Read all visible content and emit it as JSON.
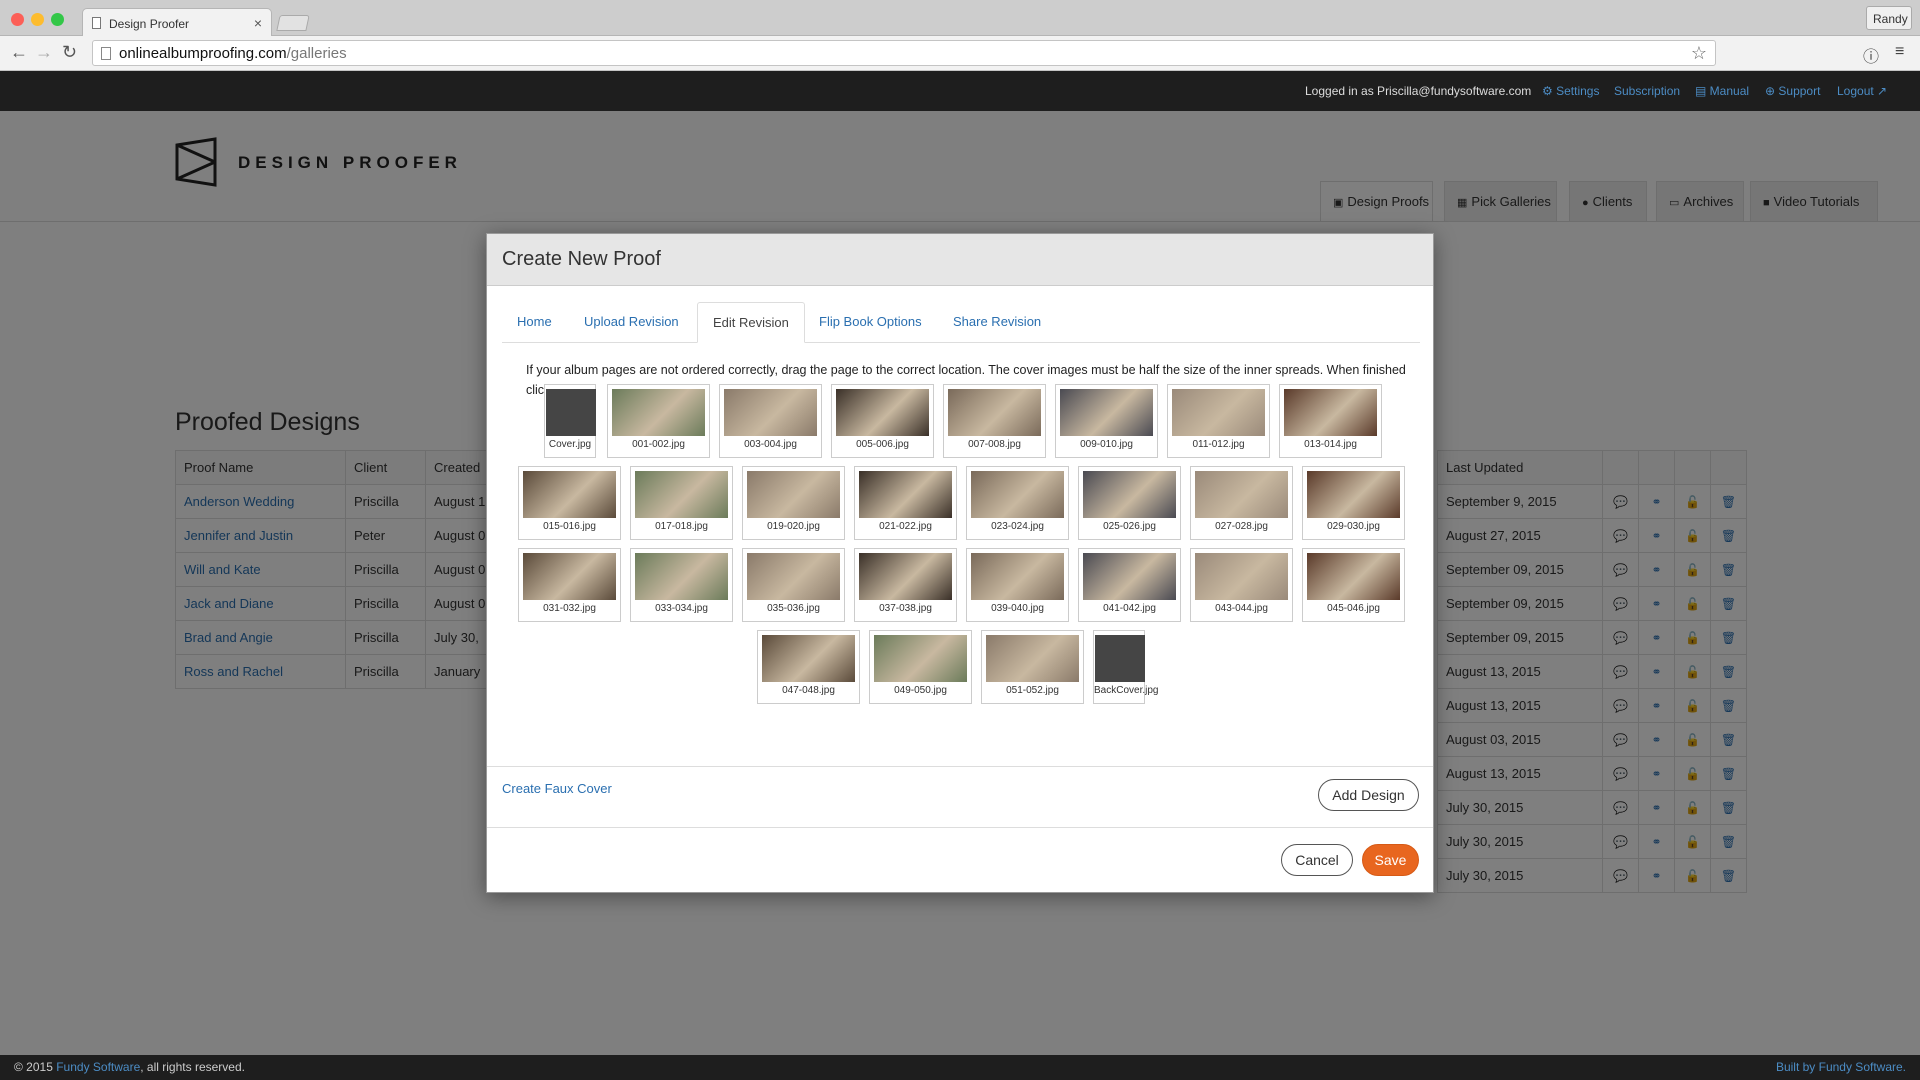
{
  "browser": {
    "tab_title": "Design Proofer",
    "tab_close": "×",
    "user": "Randy",
    "url_host": "onlinealbumproofing.com",
    "url_path": "/galleries"
  },
  "topbar": {
    "login_text": "Logged in as Priscilla@fundysoftware.com",
    "links": [
      "Settings",
      "Subscription",
      "Manual",
      "Support",
      "Logout"
    ]
  },
  "brand": "DESIGN PROOFER",
  "nav": [
    "Design Proofs",
    "Pick Galleries",
    "Clients",
    "Archives",
    "Video Tutorials"
  ],
  "page_title": "Proofed Designs",
  "table": {
    "headers": [
      "Proof Name",
      "Client",
      "Created"
    ],
    "rows": [
      [
        "Anderson Wedding",
        "Priscilla",
        "August 1"
      ],
      [
        "Jennifer and Justin",
        "Peter",
        "August 0"
      ],
      [
        "Will and Kate",
        "Priscilla",
        "August 0"
      ],
      [
        "Jack and Diane",
        "Priscilla",
        "August 0"
      ],
      [
        "Brad and Angie",
        "Priscilla",
        "July 30,"
      ],
      [
        "Ross and Rachel",
        "Priscilla",
        "January"
      ]
    ]
  },
  "rtable": {
    "header": "Last Updated",
    "rows": [
      "September 9, 2015",
      "August 27, 2015",
      "September 09, 2015",
      "September 09, 2015",
      "September 09, 2015",
      "August 13, 2015",
      "August 13, 2015",
      "August 03, 2015",
      "August 13, 2015",
      "July 30, 2015",
      "July 30, 2015",
      "July 30, 2015"
    ]
  },
  "footer": {
    "copy_prefix": "© 2015 ",
    "company": "Fundy Software",
    "copy_suffix": ", all rights reserved.",
    "built_by": "Built by Fundy Software."
  },
  "modal": {
    "title": "Create New Proof",
    "tabs": [
      "Home",
      "Upload Revision",
      "Edit Revision",
      "Flip Book Options",
      "Share Revision"
    ],
    "instructions": "If your album pages are not ordered correctly, drag the page to the correct location. The cover images must be half the size of the inner spreads. When finished click Save.",
    "thumbs": [
      [
        "Cover.jpg",
        "001-002.jpg",
        "003-004.jpg",
        "005-006.jpg",
        "007-008.jpg",
        "009-010.jpg",
        "011-012.jpg",
        "013-014.jpg"
      ],
      [
        "015-016.jpg",
        "017-018.jpg",
        "019-020.jpg",
        "021-022.jpg",
        "023-024.jpg",
        "025-026.jpg",
        "027-028.jpg",
        "029-030.jpg"
      ],
      [
        "031-032.jpg",
        "033-034.jpg",
        "035-036.jpg",
        "037-038.jpg",
        "039-040.jpg",
        "041-042.jpg",
        "043-044.jpg",
        "045-046.jpg"
      ],
      [
        "047-048.jpg",
        "049-050.jpg",
        "051-052.jpg",
        "BackCover.jpg"
      ]
    ],
    "faux_cover": "Create Faux Cover",
    "add_design": "Add Design",
    "cancel": "Cancel",
    "save": "Save"
  },
  "colors": {
    "accent": "#2a6fb0",
    "save": "#e8661f",
    "header": "#1e1e1e"
  }
}
